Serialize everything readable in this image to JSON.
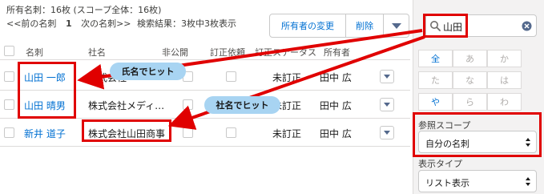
{
  "info": {
    "owner_line": "所有名刺：16枚 (スコープ全体：16枚)",
    "nav_prev": "<<前の名刺",
    "nav_page": "1",
    "nav_next": "次の名刺>>",
    "result": "検索結果：3枚中3枚表示"
  },
  "toolbar": {
    "change_owner_label": "所有者の変更",
    "delete_label": "削除"
  },
  "table": {
    "headers": [
      "名刺",
      "社名",
      "非公開",
      "訂正依頼",
      "訂正ステータス",
      "所有者"
    ],
    "rows": [
      {
        "name": "山田 一郎",
        "company": "株式会社",
        "status": "未訂正",
        "owner": "田中 広"
      },
      {
        "name": "山田 晴男",
        "company": "株式会社メディア…",
        "status": "未訂正",
        "owner": "田中 広"
      },
      {
        "name": "新井 道子",
        "company": "株式会社山田商事",
        "status": "未訂正",
        "owner": "田中 広"
      }
    ]
  },
  "sidebar": {
    "search_value": "山田",
    "kana": [
      "全",
      "あ",
      "か",
      "た",
      "な",
      "は",
      "や",
      "ら",
      "わ"
    ],
    "scope_label": "参照スコープ",
    "scope_value": "自分の名刺",
    "display_label": "表示タイプ",
    "display_value": "リスト表示"
  },
  "callouts": {
    "name_hit": "氏名でヒット",
    "company_hit": "社名でヒット"
  },
  "colors": {
    "link": "#0070d2",
    "annotation_red": "#e00000",
    "bubble": "#a8d4f2"
  }
}
